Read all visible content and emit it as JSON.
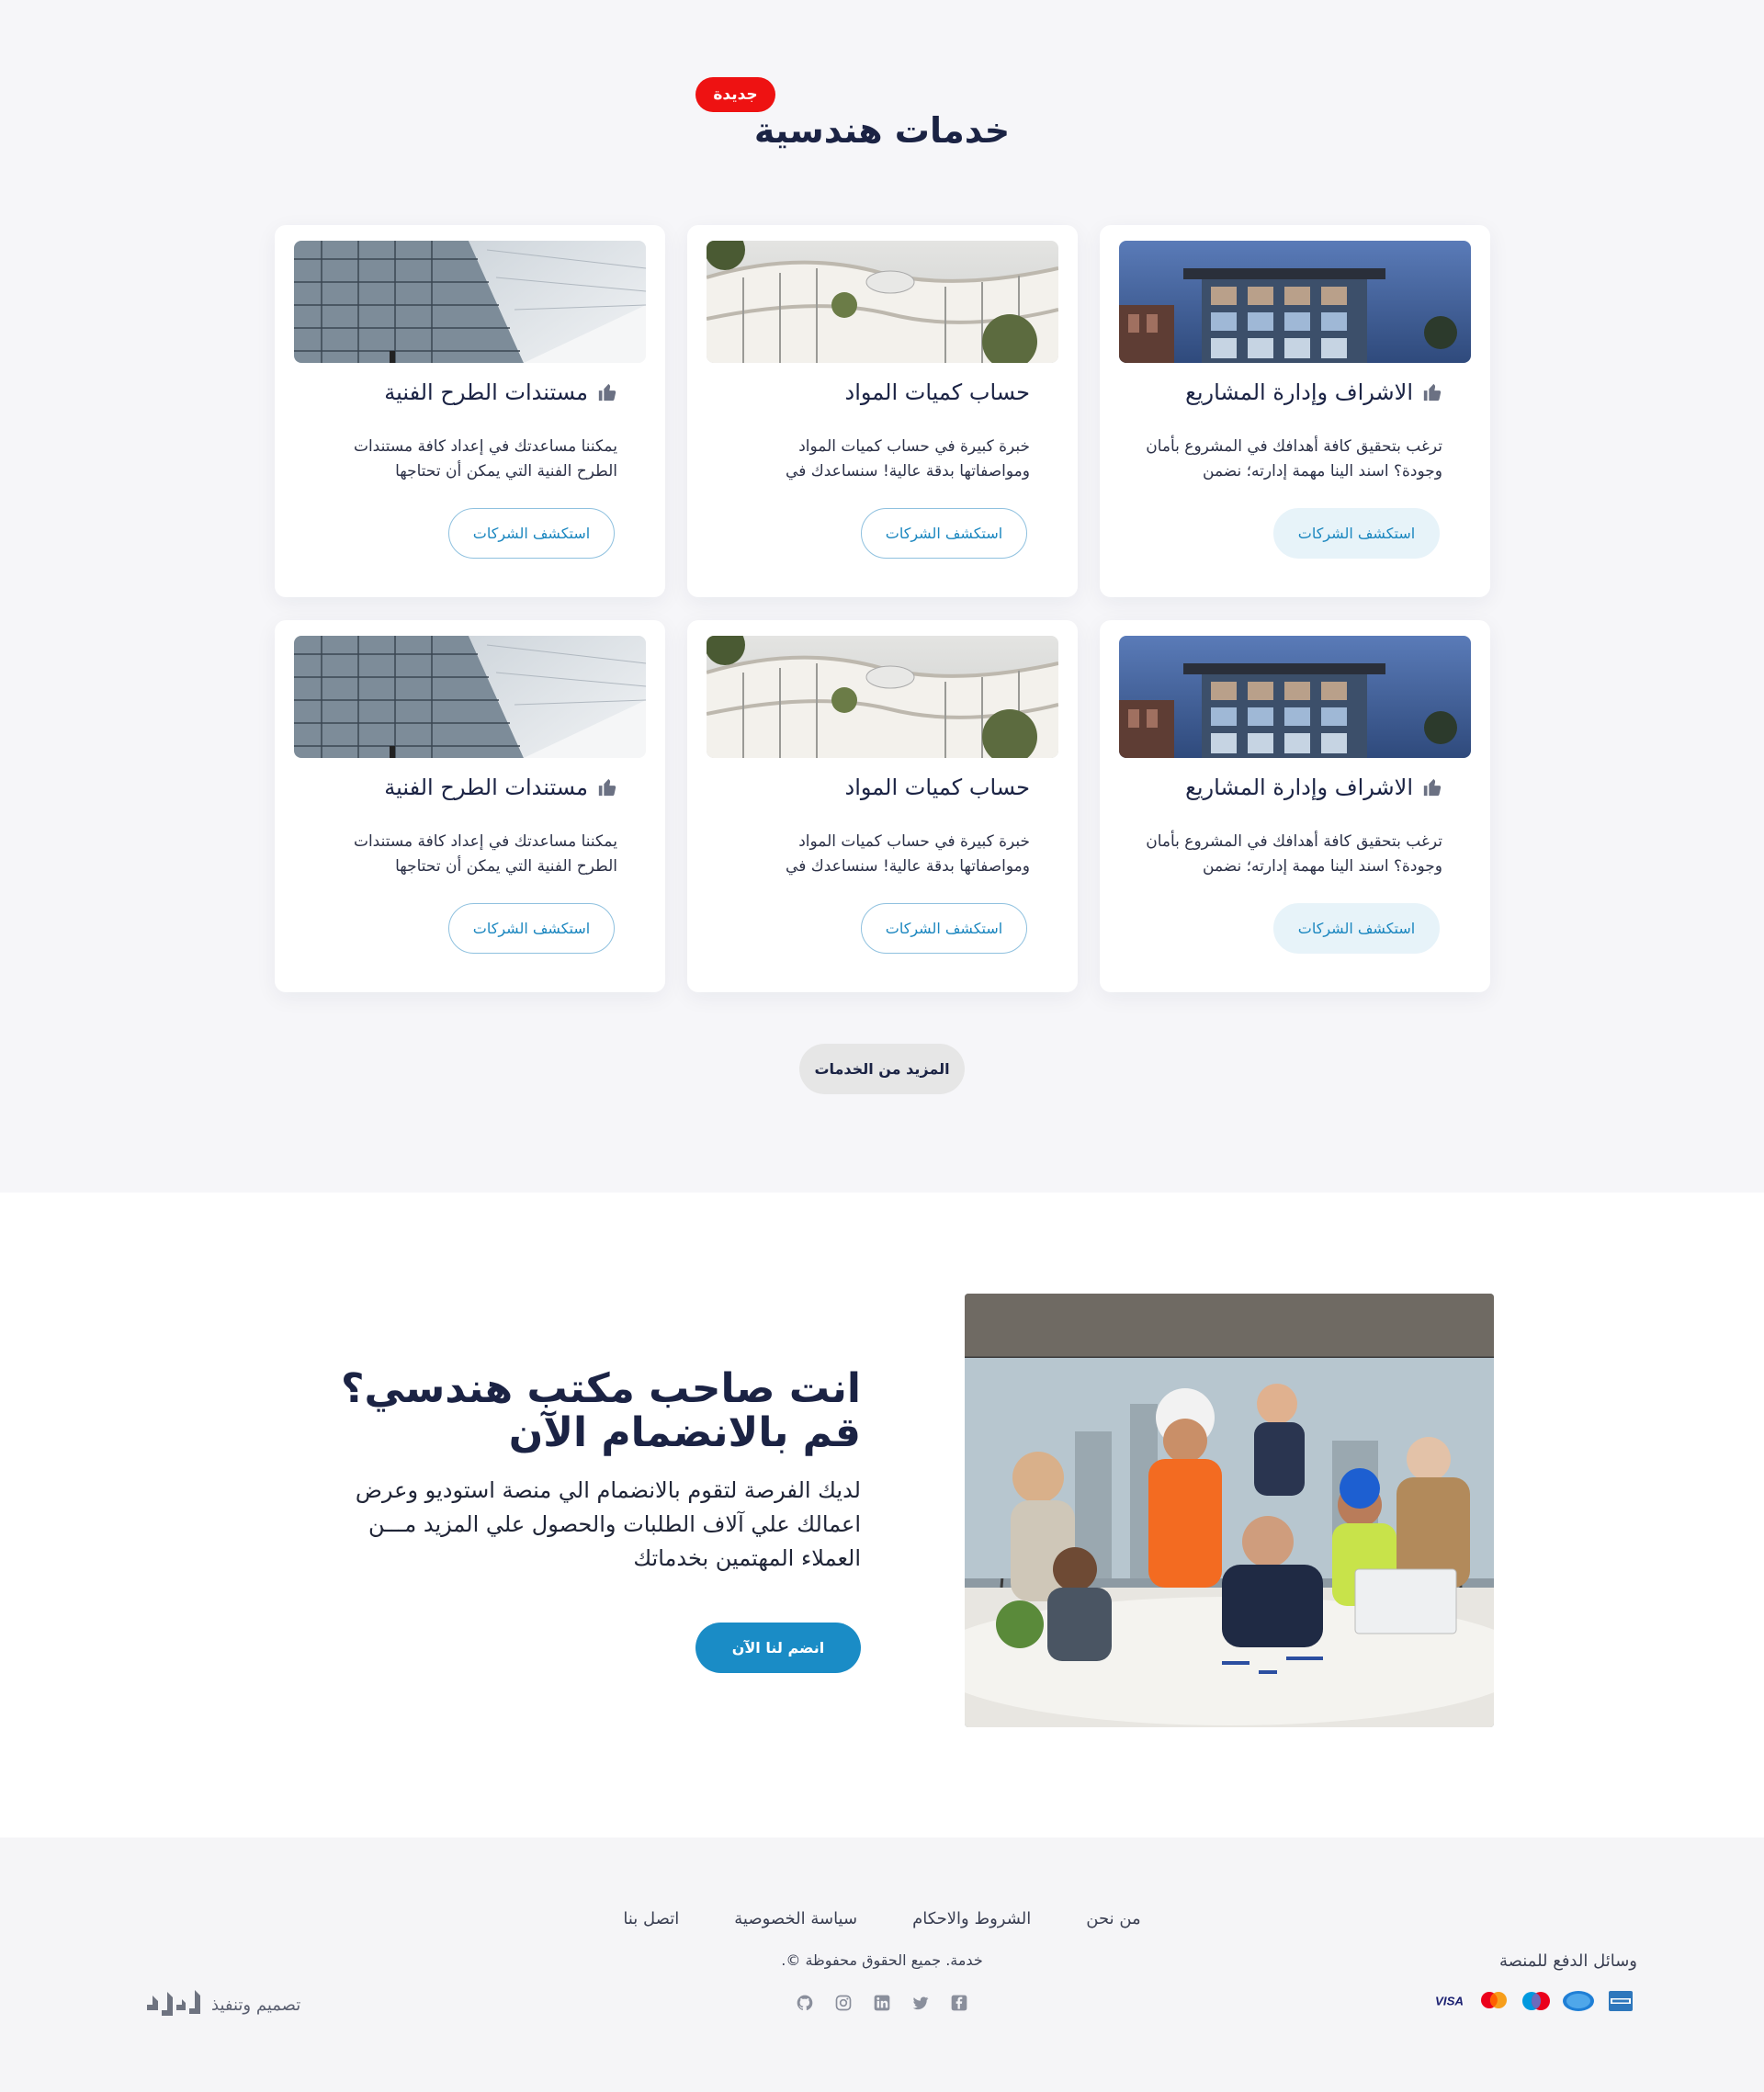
{
  "services": {
    "badge": "جديدة",
    "title": "خدمات هندسية",
    "cards": [
      {
        "title": "الاشراف وإدارة المشاريع",
        "desc": "ترغب بتحقيق كافة أهدافك في المشروع بأمان وجودة؟ اسند الينا مهمة إدارته؛ نضمن",
        "cta": "استكشف الشركات",
        "image": "building-blue-facade"
      },
      {
        "title": "حساب كميات المواد",
        "desc": "خبرة كبيرة في حساب كميات المواد ومواصفاتها بدقة عالية! سنساعدك في",
        "cta": "استكشف الشركات",
        "image": "curved-white-building"
      },
      {
        "title": "مستندات الطرح الفنية",
        "desc": "يمكننا مساعدتك في إعداد كافة مستندات الطرح الفنية التي يمكن أن تحتاجها",
        "cta": "استكشف الشركات",
        "image": "glass-tower"
      },
      {
        "title": "الاشراف وإدارة المشاريع",
        "desc": "ترغب بتحقيق كافة أهدافك في المشروع بأمان وجودة؟ اسند الينا مهمة إدارته؛ نضمن",
        "cta": "استكشف الشركات",
        "image": "building-blue-facade"
      },
      {
        "title": "حساب كميات المواد",
        "desc": "خبرة كبيرة في حساب كميات المواد ومواصفاتها بدقة عالية! سنساعدك في",
        "cta": "استكشف الشركات",
        "image": "curved-white-building"
      },
      {
        "title": "مستندات الطرح الفنية",
        "desc": "يمكننا مساعدتك في إعداد كافة مستندات الطرح الفنية التي يمكن أن تحتاجها",
        "cta": "استكشف الشركات",
        "image": "glass-tower"
      }
    ],
    "more_label": "المزيد من الخدمات"
  },
  "join": {
    "heading_line1": "انت صاحب مكتب هندسي؟",
    "heading_line2": "قم بالانضمام الآن",
    "text": "لديك الفرصة لتقوم بالانضمام الي منصة استوديو وعرض اعمالك علي آلاف الطلبات والحصول علي المزيد مـــن العملاء المهتمين بخدماتك",
    "button": "انضم لنا الآن",
    "image": "team-meeting-engineers"
  },
  "footer": {
    "links": [
      "من نحن",
      "الشروط والاحكام",
      "سياسة الخصوصية",
      "اتصل بنا"
    ],
    "copyright": "خدمة. جميع الحقوق محفوظة ©.",
    "socials": [
      "facebook-icon",
      "twitter-icon",
      "linkedin-icon",
      "instagram-icon",
      "github-icon"
    ],
    "pay_label": "وسائل الدفع للمنصة",
    "payments": [
      "VISA",
      "Mastercard",
      "Maestro",
      "Cirrus",
      "American Express"
    ],
    "credit": "تصميم وتنفيذ",
    "credit_logo": "رواد"
  },
  "colors": {
    "accent": "#1a8cc6",
    "badge": "#ee1212",
    "title": "#1b2344"
  }
}
